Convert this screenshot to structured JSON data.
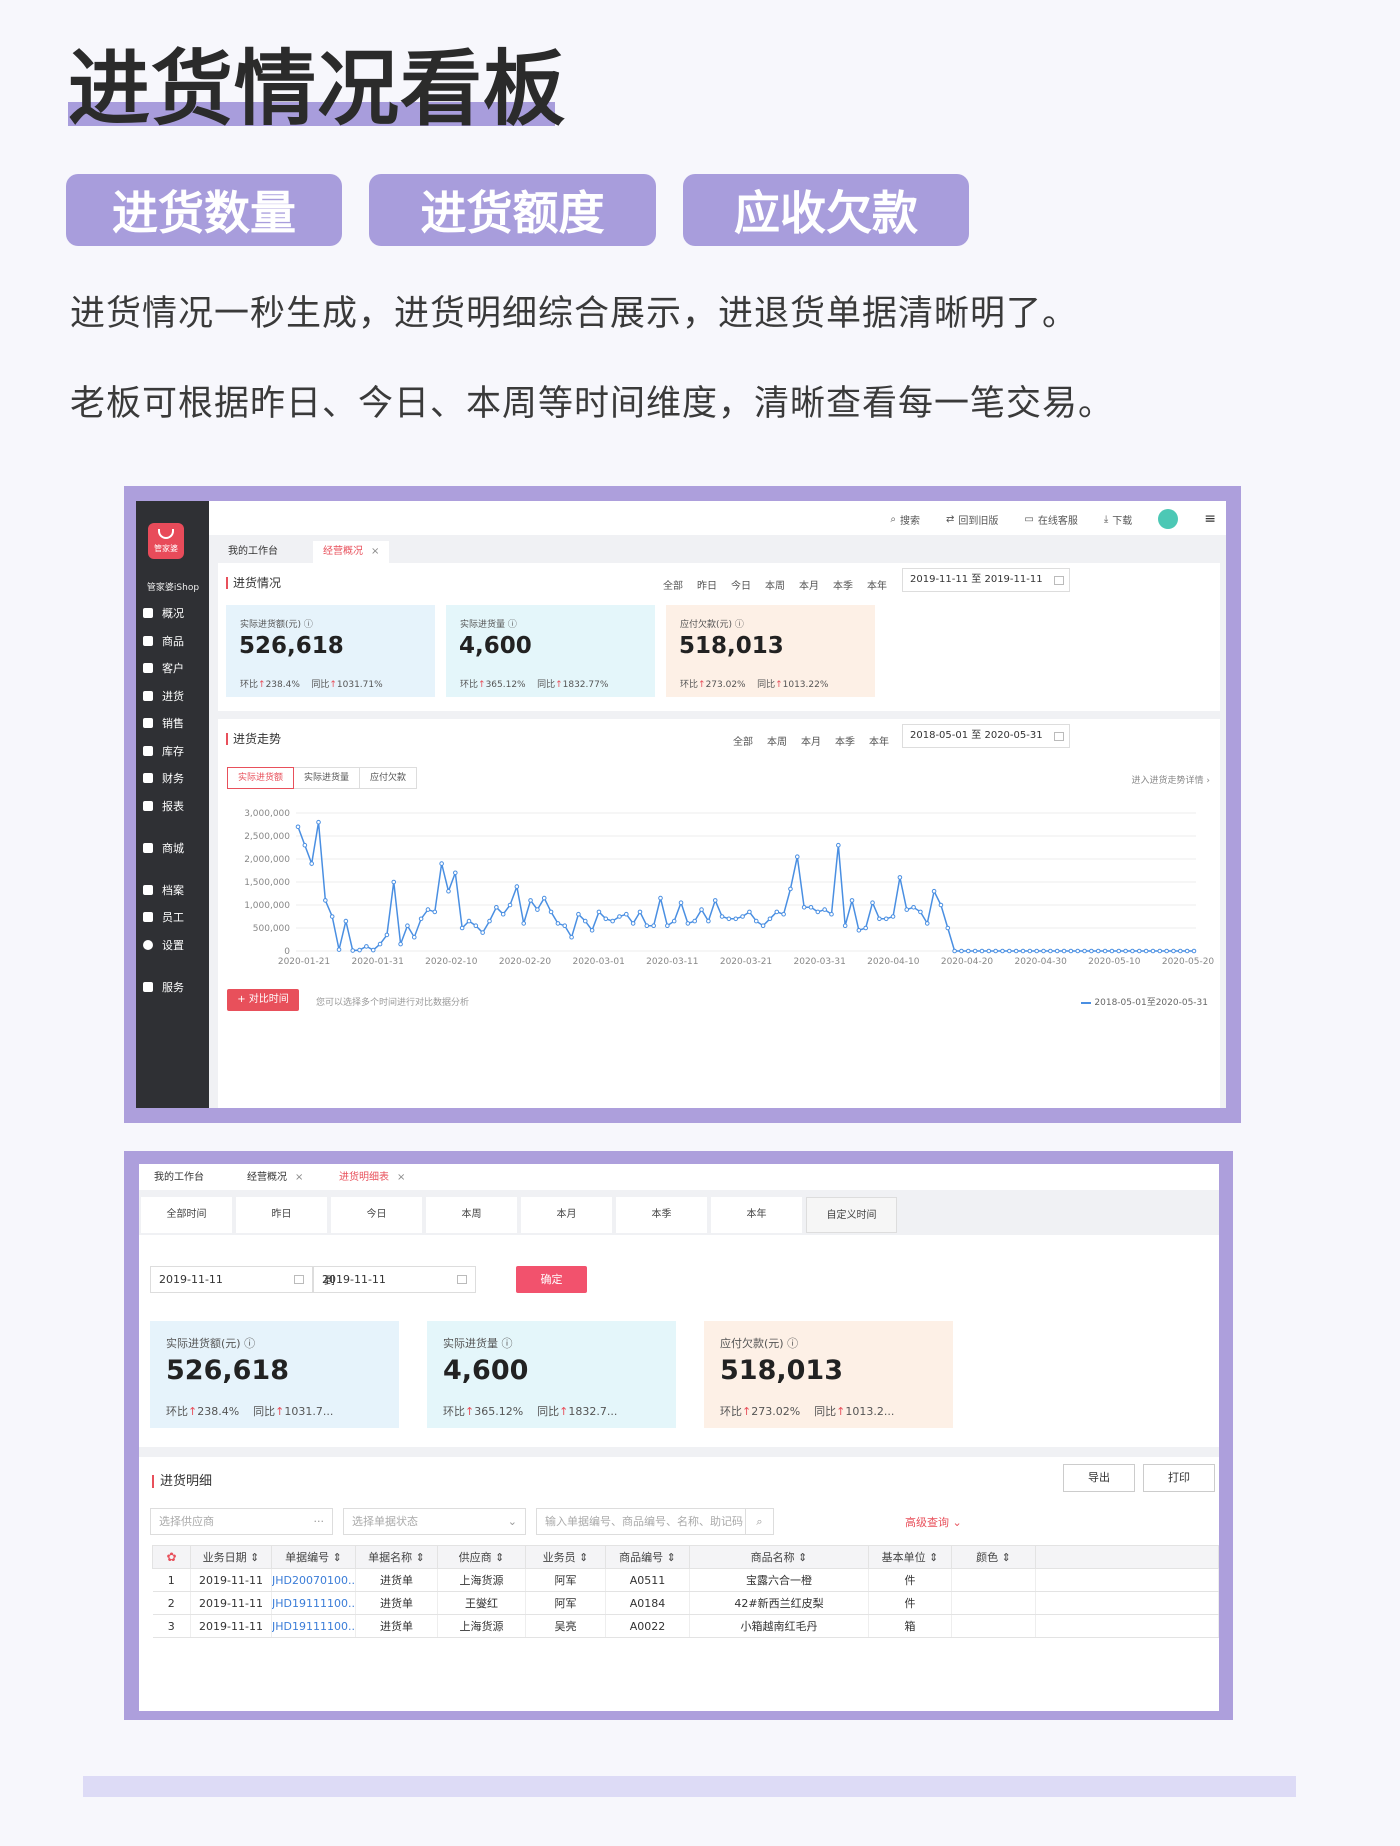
{
  "headline": "进货情况看板",
  "tags": [
    "进货数量",
    "进货额度",
    "应收欠款"
  ],
  "desc1": "进货情况一秒生成，进货明细综合展示，进退货单据清晰明了。",
  "desc2": "老板可根据昨日、今日、本周等时间维度，清晰查看每一笔交易。",
  "app": {
    "logo_text": "管家婆",
    "brand": "管家婆iShop",
    "nav": [
      "概况",
      "商品",
      "客户",
      "进货",
      "销售",
      "库存",
      "财务",
      "报表",
      "商城",
      "档案",
      "员工",
      "设置",
      "服务"
    ],
    "top": [
      "搜索",
      "回到旧版",
      "在线客服",
      "下载"
    ],
    "tabs": [
      "我的工作台",
      "经营概况"
    ],
    "section1": {
      "title": "进货情况",
      "filters": [
        "全部",
        "昨日",
        "今日",
        "本周",
        "本月",
        "本季",
        "本年"
      ],
      "date_range": "2019-11-11 至 2019-11-11"
    },
    "cards": [
      {
        "label": "实际进货额(元)",
        "value": "526,618",
        "hb_label": "环比",
        "hb": "238.4%",
        "tb_label": "同比",
        "tb": "1031.71%"
      },
      {
        "label": "实际进货量",
        "value": "4,600",
        "hb_label": "环比",
        "hb": "365.12%",
        "tb_label": "同比",
        "tb": "1832.77%"
      },
      {
        "label": "应付欠款(元)",
        "value": "518,013",
        "hb_label": "环比",
        "hb": "273.02%",
        "tb_label": "同比",
        "tb": "1013.22%"
      }
    ],
    "section2": {
      "title": "进货走势",
      "filters": [
        "全部",
        "本周",
        "本月",
        "本季",
        "本年"
      ],
      "date_range": "2018-05-01 至 2020-05-31",
      "metric_tabs": [
        "实际进货额",
        "实际进货量",
        "应付欠款"
      ],
      "detail_link": "进入进货走势详情",
      "compare_btn": "+ 对比时间",
      "compare_hint": "您可以选择多个时间进行对比数据分析",
      "legend": "2018-05-01至2020-05-31"
    }
  },
  "chart_data": {
    "type": "line",
    "y_ticks": [
      "3,000,000",
      "2,500,000",
      "2,000,000",
      "1,500,000",
      "1,000,000",
      "500,000",
      "0"
    ],
    "x_ticks": [
      "2020-01-21",
      "2020-01-31",
      "2020-02-10",
      "2020-02-20",
      "2020-03-01",
      "2020-03-11",
      "2020-03-21",
      "2020-03-31",
      "2020-04-10",
      "2020-04-20",
      "2020-04-30",
      "2020-05-10",
      "2020-05-20"
    ],
    "ylim": [
      0,
      3000000
    ],
    "series": [
      {
        "name": "2018-05-01至2020-05-31",
        "color": "#4a8fe2",
        "values": [
          2700000,
          2300000,
          1900000,
          2800000,
          1100000,
          750000,
          30000,
          650000,
          10000,
          20000,
          100000,
          20000,
          150000,
          350000,
          1500000,
          150000,
          550000,
          300000,
          700000,
          900000,
          850000,
          1900000,
          1300000,
          1700000,
          500000,
          650000,
          550000,
          400000,
          650000,
          950000,
          800000,
          1000000,
          1400000,
          600000,
          1100000,
          900000,
          1150000,
          850000,
          600000,
          550000,
          300000,
          800000,
          650000,
          450000,
          850000,
          700000,
          650000,
          750000,
          800000,
          600000,
          850000,
          550000,
          550000,
          1150000,
          550000,
          650000,
          1050000,
          600000,
          650000,
          900000,
          650000,
          1100000,
          750000,
          700000,
          700000,
          750000,
          850000,
          650000,
          550000,
          700000,
          850000,
          800000,
          1350000,
          2050000,
          950000,
          950000,
          850000,
          900000,
          800000,
          2300000,
          550000,
          1100000,
          450000,
          500000,
          1050000,
          700000,
          700000,
          750000,
          1600000,
          900000,
          950000,
          850000,
          600000,
          1300000,
          1000000,
          500000,
          0,
          0,
          0,
          0,
          0,
          0,
          0,
          0,
          0,
          0,
          0,
          0,
          0,
          0,
          0,
          0,
          0,
          0,
          0,
          0,
          0,
          0,
          0,
          0,
          0,
          0,
          0,
          0,
          0,
          0,
          0,
          0,
          0,
          0,
          0,
          0
        ]
      }
    ]
  },
  "app2": {
    "tabs": [
      "我的工作台",
      "经营概况",
      "进货明细表"
    ],
    "periods": [
      "全部时间",
      "昨日",
      "今日",
      "本周",
      "本月",
      "本季",
      "本年",
      "自定义时间"
    ],
    "date_from": "2019-11-11",
    "to_label": "到",
    "date_to": "2019-11-11",
    "ok_btn": "确定",
    "cards": [
      {
        "label": "实际进货额(元)",
        "value": "526,618",
        "hb_label": "环比",
        "hb": "238.4%",
        "tb_label": "同比",
        "tb": "1031.7..."
      },
      {
        "label": "实际进货量",
        "value": "4,600",
        "hb_label": "环比",
        "hb": "365.12%",
        "tb_label": "同比",
        "tb": "1832.7..."
      },
      {
        "label": "应付欠款(元)",
        "value": "518,013",
        "hb_label": "环比",
        "hb": "273.02%",
        "tb_label": "同比",
        "tb": "1013.2..."
      }
    ],
    "detail_title": "进货明细",
    "export_btn": "导出",
    "print_btn": "打印",
    "supplier_ph": "选择供应商",
    "status_ph": "选择单据状态",
    "search_ph": "输入单据编号、商品编号、名称、助记码",
    "adv_search": "高级查询",
    "columns": [
      "业务日期",
      "单据编号",
      "单据名称",
      "供应商",
      "业务员",
      "商品编号",
      "商品名称",
      "基本单位",
      "颜色"
    ],
    "rows": [
      [
        "1",
        "2019-11-11",
        "JHD20070100..",
        "进货单",
        "上海货源",
        "阿军",
        "A0511",
        "宝露六合一橙",
        "件",
        ""
      ],
      [
        "2",
        "2019-11-11",
        "JHD19111100..",
        "进货单",
        "王燮红",
        "阿军",
        "A0184",
        "42#新西兰红皮梨",
        "件",
        ""
      ],
      [
        "3",
        "2019-11-11",
        "JHD19111100..",
        "进货单",
        "上海货源",
        "吴亮",
        "A0022",
        "小箱越南红毛丹",
        "箱",
        ""
      ]
    ]
  },
  "colors": {
    "accent_purple": "#a89ddc",
    "brand_red": "#e8505b",
    "line_blue": "#4a8fe2"
  }
}
